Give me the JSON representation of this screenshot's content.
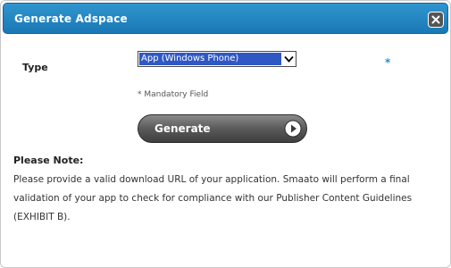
{
  "dialog": {
    "title": "Generate Adspace",
    "close_icon": "close-icon",
    "close_color": "#555555",
    "titlebar_color": "#2387c4"
  },
  "form": {
    "type_label": "Type",
    "type_select": {
      "selected": "App (Windows Phone)",
      "arrow_icon": "chevron-down-icon"
    },
    "required_marker": "*",
    "mandatory_note": "* Mandatory Field",
    "generate_button": {
      "label": "Generate",
      "icon": "play-circle-icon"
    }
  },
  "note": {
    "heading": "Please Note:",
    "body": "Please provide a valid download URL of your application. Smaato will perform a final validation of your app to check for compliance with our Publisher Content Guidelines (EXHIBIT B)."
  }
}
